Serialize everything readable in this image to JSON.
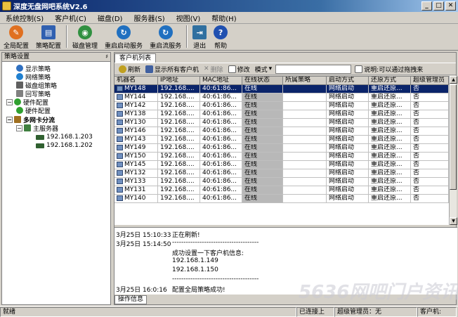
{
  "window": {
    "title": "深度无盘网吧系统V2.6",
    "min": "_",
    "max": "□",
    "close": "✕"
  },
  "menu": [
    "系统控制(S)",
    "客户机(C)",
    "磁盘(D)",
    "服务器(S)",
    "视图(V)",
    "帮助(H)"
  ],
  "toolbar": [
    {
      "label": "全局配置",
      "color": "#e07020",
      "icon": "wrench-icon",
      "glyph": "✎"
    },
    {
      "label": "策略配置",
      "color": "#3060b0",
      "icon": "monitor-icon",
      "glyph": "▤"
    },
    {
      "label": "磁盘管理",
      "color": "#309040",
      "icon": "disk-icon",
      "glyph": "◉"
    },
    {
      "label": "重启启动服务",
      "color": "#2070c0",
      "icon": "restart-icon",
      "glyph": "↻"
    },
    {
      "label": "重启流服务",
      "color": "#2070c0",
      "icon": "restart-stream-icon",
      "glyph": "↻"
    },
    {
      "label": "退出",
      "color": "#3070a0",
      "icon": "exit-icon",
      "glyph": "⇥"
    },
    {
      "label": "帮助",
      "color": "#2050b0",
      "icon": "help-icon",
      "glyph": "?"
    }
  ],
  "left_panel": {
    "title": "策略设置",
    "pin": "♯",
    "tree": [
      {
        "label": "显示策略",
        "color": "#3070c0",
        "icon": "display-icon"
      },
      {
        "label": "网络策略",
        "color": "#2080d0",
        "icon": "network-icon"
      },
      {
        "label": "磁盘组策略",
        "color": "#606060",
        "icon": "disk-group-icon"
      },
      {
        "label": "回写策略",
        "color": "#808080",
        "icon": "writeback-icon"
      },
      {
        "label": "硬件配置",
        "color": "#30a030",
        "icon": "hardware-icon",
        "expander": "−"
      },
      {
        "label": "硬件配置",
        "color": "#30a030",
        "icon": "hardware-config-icon"
      },
      {
        "label": "多网卡分流",
        "color": "#a07020",
        "icon": "multi-nic-icon",
        "expander": "−"
      },
      {
        "label": "主服务器",
        "color": "#408040",
        "icon": "main-server-icon",
        "expander": "−"
      },
      {
        "label": "192.168.1.203",
        "color": "#306030",
        "icon": "server-ip-icon"
      },
      {
        "label": "192.168.1.202",
        "color": "#306030",
        "icon": "server-ip-icon"
      }
    ]
  },
  "tab": "客户机列表",
  "grid_toolbar": {
    "refresh": "刷新",
    "show_all": "显示所有客户机",
    "delete": "删除",
    "modify": "修改",
    "mode": "模式",
    "hint": "说明:可以通过拖拽来",
    "mode_arrow": "▾"
  },
  "columns": [
    "机器名",
    "IP地址",
    "MAC地址",
    "在线状态",
    "所属策略",
    "启动方式",
    "还原方式",
    "超级管理员"
  ],
  "rows": [
    [
      "MY148",
      "192.168....",
      "40:61:86...",
      "在线",
      "",
      "网络启动",
      "重启还原...",
      "否"
    ],
    [
      "MY144",
      "192.168....",
      "40:61:86...",
      "在线",
      "",
      "网络启动",
      "重启还原...",
      "否"
    ],
    [
      "MY142",
      "192.168....",
      "40:61:86...",
      "在线",
      "",
      "网络启动",
      "重启还原...",
      "否"
    ],
    [
      "MY138",
      "192.168....",
      "40:61:86...",
      "在线",
      "",
      "网络启动",
      "重启还原...",
      "否"
    ],
    [
      "MY130",
      "192.168....",
      "40:61:86...",
      "在线",
      "",
      "网络启动",
      "重启还原...",
      "否"
    ],
    [
      "MY146",
      "192.168....",
      "40:61:86...",
      "在线",
      "",
      "网络启动",
      "重启还原...",
      "否"
    ],
    [
      "MY143",
      "192.168....",
      "40:61:86...",
      "在线",
      "",
      "网络启动",
      "重启还原...",
      "否"
    ],
    [
      "MY149",
      "192.168....",
      "40:61:86...",
      "在线",
      "",
      "网络启动",
      "重启还原...",
      "否"
    ],
    [
      "MY150",
      "192.168....",
      "40:61:86...",
      "在线",
      "",
      "网络启动",
      "重启还原...",
      "否"
    ],
    [
      "MY145",
      "192.168....",
      "40:61:86...",
      "在线",
      "",
      "网络启动",
      "重启还原...",
      "否"
    ],
    [
      "MY132",
      "192.168....",
      "40:61:86...",
      "在线",
      "",
      "网络启动",
      "重启还原...",
      "否"
    ],
    [
      "MY133",
      "192.168....",
      "40:61:86...",
      "在线",
      "",
      "网络启动",
      "重启还原...",
      "否"
    ],
    [
      "MY131",
      "192.168....",
      "40:61:86...",
      "在线",
      "",
      "网络启动",
      "重启还原...",
      "否"
    ],
    [
      "MY140",
      "192.168....",
      "40:61:86...",
      "在线",
      "",
      "网络启动",
      "重启还原...",
      "否"
    ]
  ],
  "log": {
    "lines": [
      {
        "time": "3月25日 15:10:33",
        "text": "正在刷新!"
      },
      {
        "time": "3月25日 15:14:50",
        "text": "--------------------------------------"
      },
      {
        "time": "",
        "text": "成功设置一下客户机信息:"
      },
      {
        "time": "",
        "text": "192.168.1.149"
      },
      {
        "time": "",
        "text": "192.168.1.150"
      },
      {
        "time": "",
        "text": "--------------------------------------"
      },
      {
        "time": "3月25日 16:0:16",
        "text": "配置全局策略成功!"
      }
    ],
    "tab": "操作信息"
  },
  "status": {
    "ready": "就绪",
    "connected": "已连接上",
    "admin": "超级管理员：无",
    "client": "客户机:"
  },
  "watermark": "5636网吧门户资讯"
}
